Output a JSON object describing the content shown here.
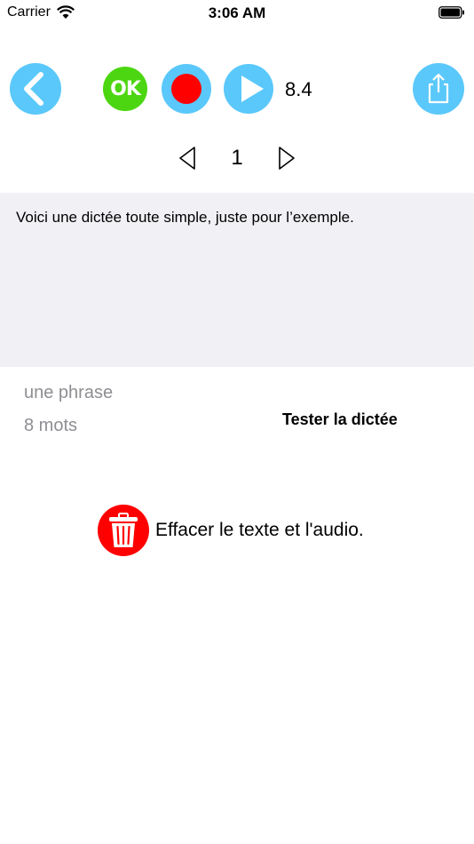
{
  "status_bar": {
    "carrier": "Carrier",
    "time": "3:06 AM"
  },
  "toolbar": {
    "ok_label": "OK",
    "duration": "8.4",
    "accent_color": "#5ac8fa",
    "ok_color": "#4cd611",
    "record_color": "#ff0000",
    "icons": [
      "chevron-left-icon",
      "record-icon",
      "play-icon",
      "share-icon"
    ]
  },
  "pager": {
    "current": "1"
  },
  "dictation": {
    "text": "Voici une dictée toute simple, juste pour l’exemple.",
    "phrase_count": "une phrase",
    "word_count": "8 mots",
    "test_label": "Tester la dictée"
  },
  "erase": {
    "label": "Effacer le texte et l'audio.",
    "icon": "trash-icon"
  }
}
